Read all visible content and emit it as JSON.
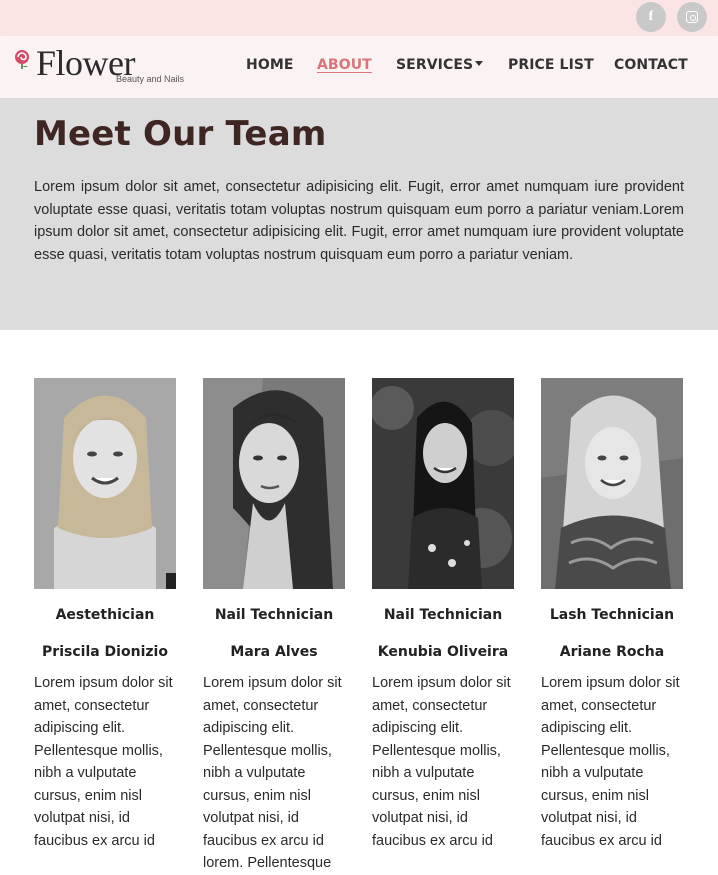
{
  "social": {
    "facebook_icon": "facebook-icon",
    "facebook_glyph": "f",
    "instagram_icon": "instagram-icon"
  },
  "brand": {
    "name": "Flower",
    "tagline": "Beauty and Nails"
  },
  "nav": {
    "items": [
      {
        "label": "HOME",
        "active": false
      },
      {
        "label": "ABOUT",
        "active": true
      },
      {
        "label": "SERVICES",
        "active": false,
        "dropdown": true
      },
      {
        "label": "PRICE LIST",
        "active": false
      },
      {
        "label": "CONTACT",
        "active": false
      }
    ]
  },
  "hero": {
    "title": "Meet Our Team",
    "text": "Lorem ipsum dolor sit amet, consectetur adipisicing elit. Fugit, error amet numquam iure provident voluptate esse quasi, veritatis totam voluptas nostrum quisquam eum porro a pariatur veniam.Lorem ipsum dolor sit amet, consectetur adipisicing elit. Fugit, error amet numquam iure provident voluptate esse quasi, veritatis totam voluptas nostrum quisquam eum porro a pariatur veniam."
  },
  "team": [
    {
      "role": "Aestethician",
      "name": "Priscila Dionizio",
      "bio": "Lorem ipsum dolor sit amet, consectetur adipiscing elit. Pellentesque mollis, nibh a vulputate cursus, enim nisl volutpat nisi, id faucibus ex arcu id"
    },
    {
      "role": "Nail Technician",
      "name": "Mara Alves",
      "bio": "Lorem ipsum dolor sit amet, consectetur adipiscing elit. Pellentesque mollis, nibh a vulputate cursus, enim nisl volutpat nisi, id faucibus ex arcu id lorem. Pellentesque"
    },
    {
      "role": "Nail Technician",
      "name": "Kenubia Oliveira",
      "bio": "Lorem ipsum dolor sit amet, consectetur adipiscing elit. Pellentesque mollis, nibh a vulputate cursus, enim nisl volutpat nisi, id faucibus ex arcu id"
    },
    {
      "role": "Lash Technician",
      "name": "Ariane Rocha",
      "bio": "Lorem ipsum dolor sit amet, consectetur adipiscing elit. Pellentesque mollis, nibh a vulputate cursus, enim nisl volutpat nisi, id faucibus ex arcu id"
    }
  ],
  "colors": {
    "topbar": "#fbe4e4",
    "navbar": "#fbf3f3",
    "active_link": "#d9747a",
    "hero_bg": "#dcdcdc",
    "title": "#3e2723"
  }
}
